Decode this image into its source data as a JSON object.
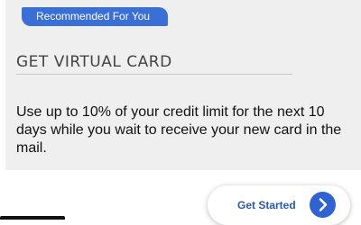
{
  "promo": {
    "badge": "Recommended For You",
    "title": "GET VIRTUAL CARD",
    "description": "Use up to 10% of your credit limit for the next 10 days while you wait to receive your new card in the mail.",
    "cta_label": "Get Started",
    "cta_icon": "chevron-right-icon"
  },
  "colors": {
    "card_background": "#efefef",
    "badge_background": "#3a6fd8",
    "cta_text": "#2b58b3",
    "cta_icon_background": "#2f63d4"
  }
}
